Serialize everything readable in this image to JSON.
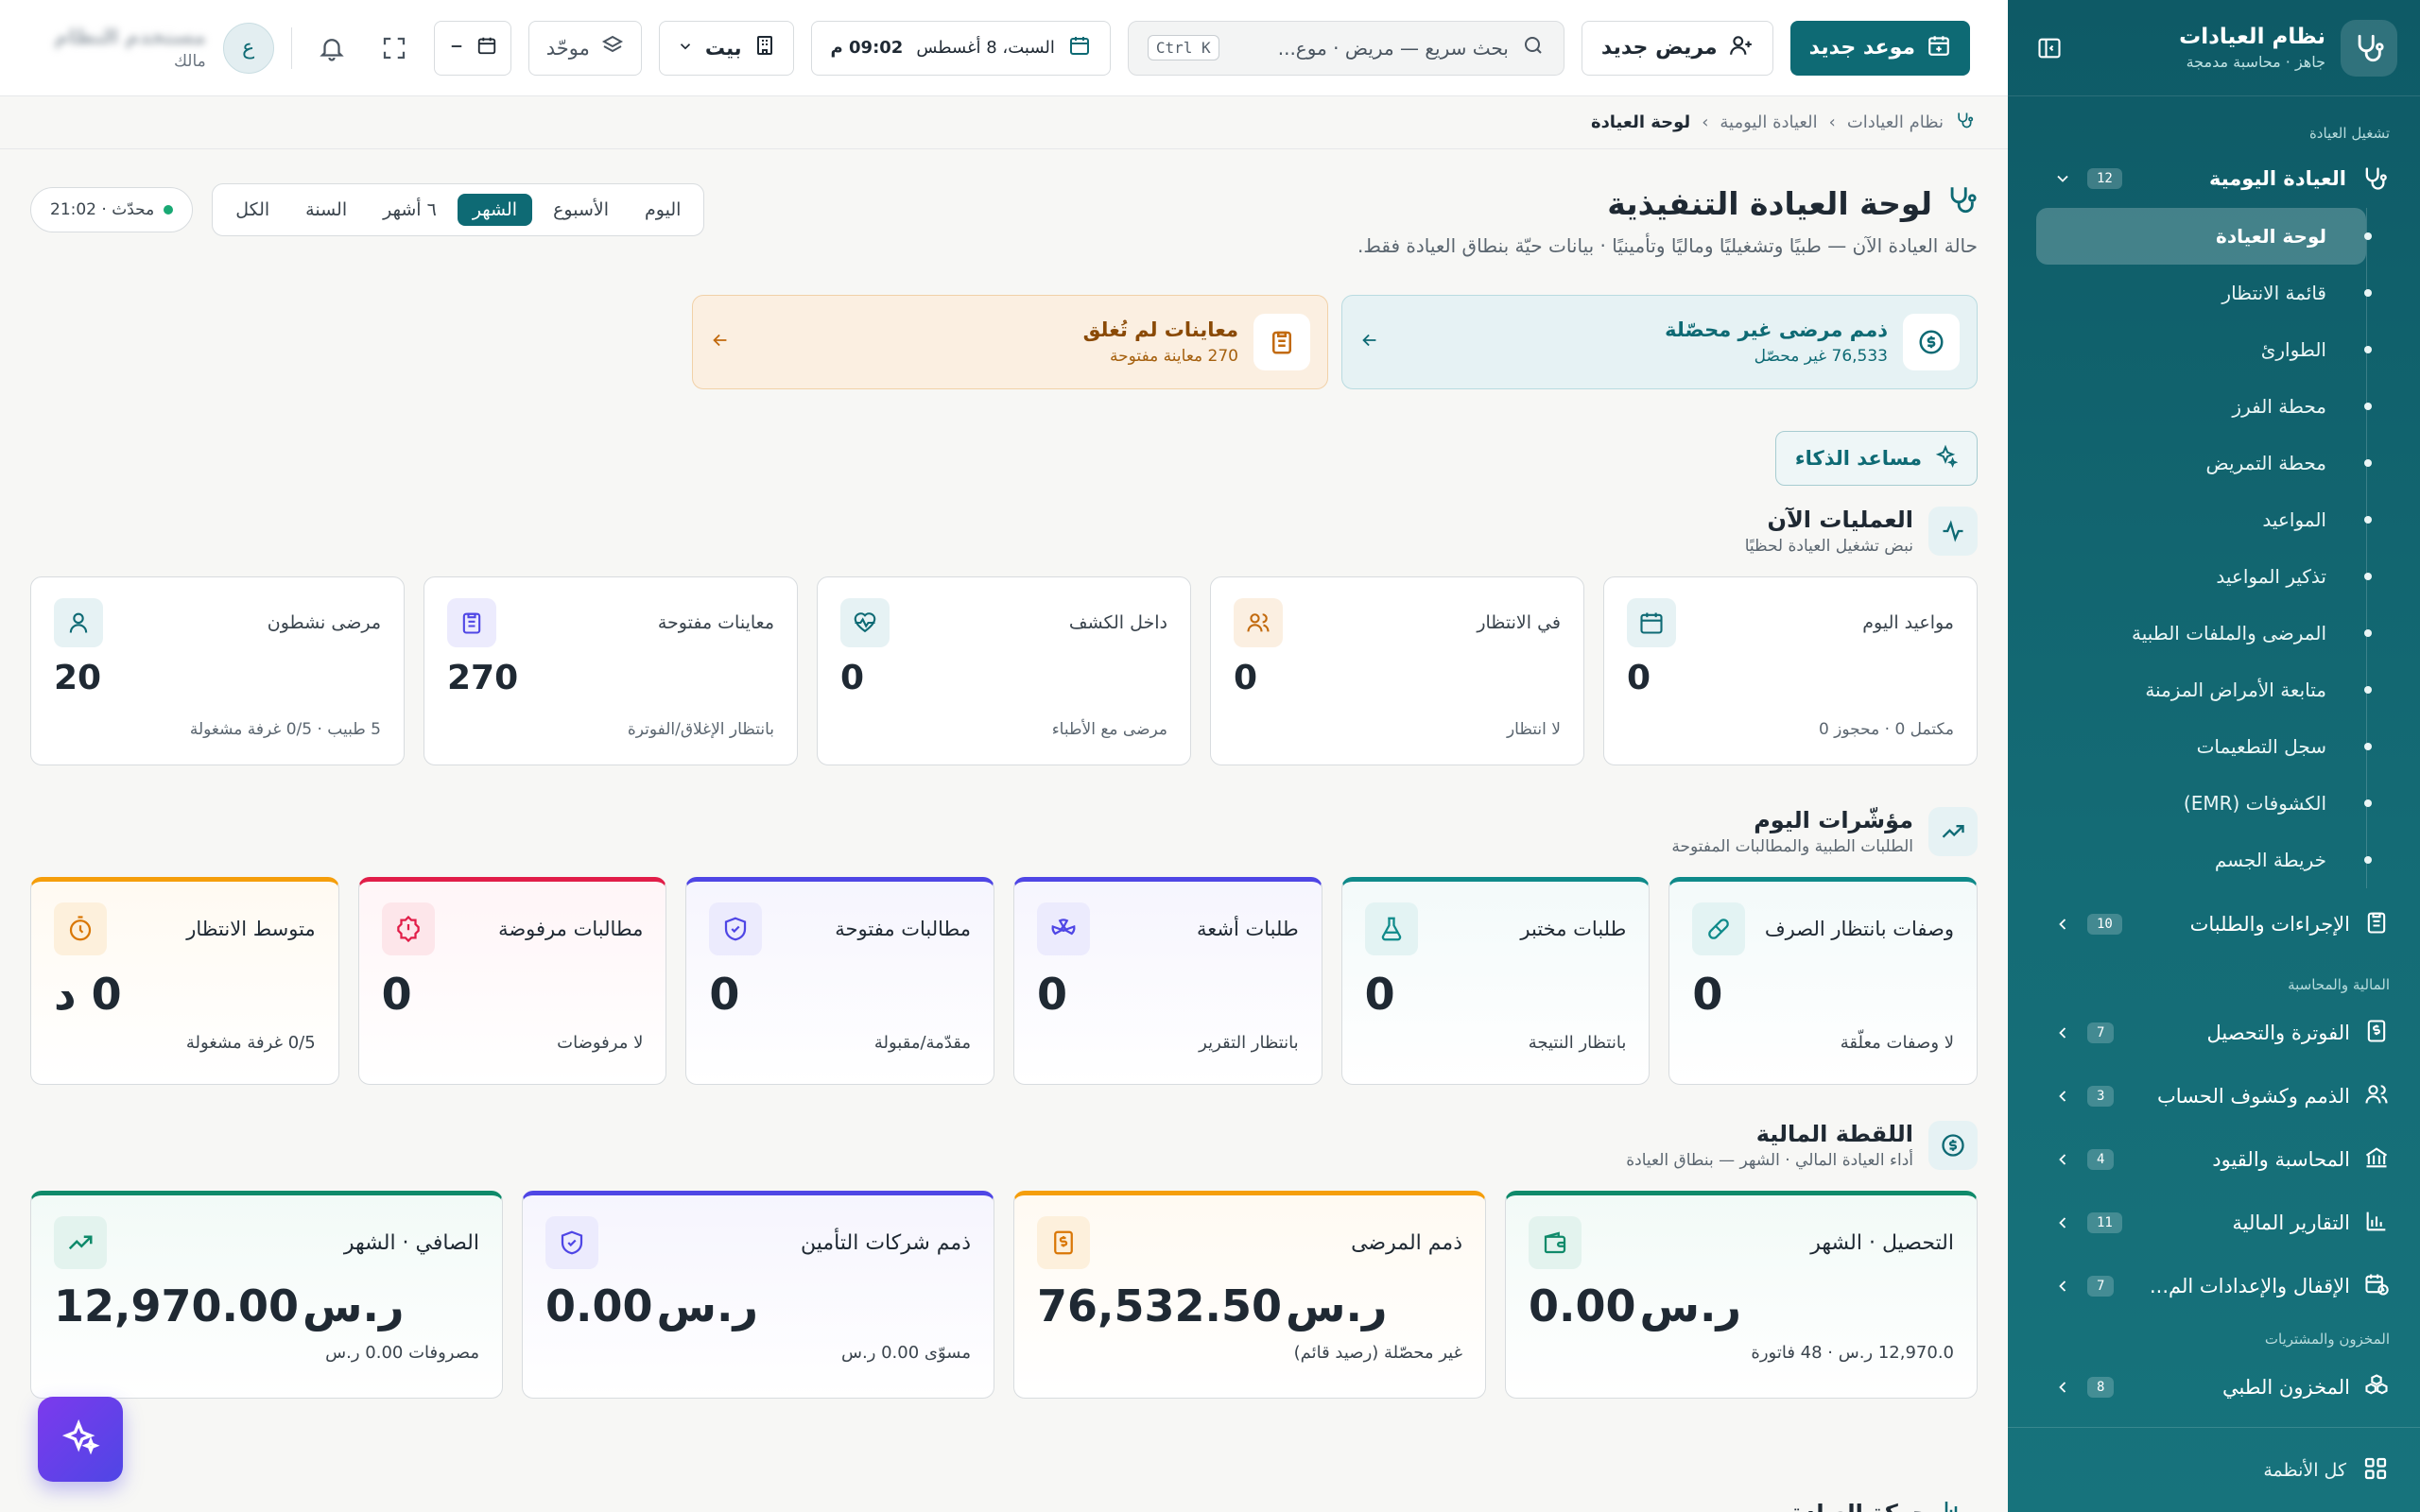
{
  "sidebar": {
    "app_title": "نظام العيادات",
    "app_subtitle": "جاهز · محاسبة مدمجة",
    "group_clinic": "تشغيل العيادة",
    "daily": {
      "label": "العيادة اليومية",
      "badge": "12"
    },
    "daily_children": [
      "لوحة العيادة",
      "قائمة الانتظار",
      "الطوارئ",
      "محطة الفرز",
      "محطة التمريض",
      "المواعيد",
      "تذكير المواعيد",
      "المرضى والملفات الطبية",
      "متابعة الأمراض المزمنة",
      "سجل التطعيمات",
      "الكشوفات (EMR)",
      "خريطة الجسم"
    ],
    "procedures": {
      "label": "الإجراءات والطلبات",
      "badge": "10"
    },
    "group_finance": "المالية والمحاسبة",
    "finance_items": [
      {
        "label": "الفوترة والتحصيل",
        "badge": "7"
      },
      {
        "label": "الذمم وكشوف الحساب",
        "badge": "3"
      },
      {
        "label": "المحاسبة والقيود",
        "badge": "4"
      },
      {
        "label": "التقارير المالية",
        "badge": "11"
      },
      {
        "label": "الإقفال والإعدادات الم...",
        "badge": "7"
      }
    ],
    "group_inventory": "المخزون والمشتريات",
    "inventory": {
      "label": "المخزون الطبي",
      "badge": "8"
    },
    "footer": "كل الأنظمة"
  },
  "topbar": {
    "new_appointment": "موعد جديد",
    "new_patient": "مريض جديد",
    "search_placeholder": "بحث سريع — مريض · موع...",
    "search_kbd": "Ctrl K",
    "date_text": "السبت، 8 أغسطس",
    "time_text": "09:02 م",
    "branch": "بيت",
    "unified": "موحّد",
    "user_name": "مستخدم النظام",
    "user_role": "مالك",
    "avatar_letter": "ع"
  },
  "breadcrumb": [
    "نظام العيادات",
    "العيادة اليومية",
    "لوحة العيادة"
  ],
  "page": {
    "title": "لوحة العيادة التنفيذية",
    "subtitle": "حالة العيادة الآن — طبيًا وتشغيليًا وماليًا وتأمينيًا · بيانات حيّة بنطاق العيادة فقط.",
    "periods": [
      "اليوم",
      "الأسبوع",
      "الشهر",
      "٦ أشهر",
      "السنة",
      "الكل"
    ],
    "active_period": "الشهر",
    "updated": "محدّث · 21:02"
  },
  "alerts": [
    {
      "title": "ذمم مرضى غير محصّلة",
      "sub": "76,533 غير محصّل",
      "tone": "teal"
    },
    {
      "title": "معاينات لم تُغلق",
      "sub": "270 معاينة مفتوحة",
      "tone": "orange"
    }
  ],
  "ai_button": "مساعد الذكاء",
  "operations": {
    "title": "العمليات الآن",
    "subtitle": "نبض تشغيل العيادة لحظيًا",
    "cards": [
      {
        "label": "مواعيد اليوم",
        "value": "0",
        "footer": "مكتمل 0 · محجوز 0",
        "icon": "calendar-icon",
        "color": "#0e6a74",
        "bg": "#e6f2f4"
      },
      {
        "label": "في الانتظار",
        "value": "0",
        "footer": "لا انتظار",
        "icon": "users-icon",
        "color": "#c26a0e",
        "bg": "#fbefe1"
      },
      {
        "label": "داخل الكشف",
        "value": "0",
        "footer": "مرضى مع الأطباء",
        "icon": "heart-pulse-icon",
        "color": "#0e6a74",
        "bg": "#e6f2f4"
      },
      {
        "label": "معاينات مفتوحة",
        "value": "270",
        "footer": "بانتظار الإغلاق/الفوترة",
        "icon": "clipboard-icon",
        "color": "#4f46e5",
        "bg": "#ecebfd"
      },
      {
        "label": "مرضى نشطون",
        "value": "20",
        "footer": "5 طبيب · 0/5 غرفة مشغولة",
        "icon": "user-icon",
        "color": "#0e6a74",
        "bg": "#e6f2f4"
      }
    ]
  },
  "indicators": {
    "title": "مؤشّرات اليوم",
    "subtitle": "الطلبات الطبية والمطالبات المفتوحة",
    "cards": [
      {
        "label": "وصفات بانتظار الصرف",
        "value": "0",
        "footer": "لا وصفات معلّقة",
        "icon": "pill-icon",
        "accent": "#0f8a8a",
        "bg": "#e3f3f3"
      },
      {
        "label": "طلبات مختبر",
        "value": "0",
        "footer": "بانتظار النتيجة",
        "icon": "flask-icon",
        "accent": "#0f8a8a",
        "bg": "#e3f3f3"
      },
      {
        "label": "طلبات أشعة",
        "value": "0",
        "footer": "بانتظار التقرير",
        "icon": "radiation-icon",
        "accent": "#4f46e5",
        "bg": "#ecebfd"
      },
      {
        "label": "مطالبات مفتوحة",
        "value": "0",
        "footer": "مقدّمة/مقبولة",
        "icon": "shield-check-icon",
        "accent": "#4f46e5",
        "bg": "#ecebfd"
      },
      {
        "label": "مطالبات مرفوضة",
        "value": "0",
        "footer": "لا مرفوضات",
        "icon": "alert-badge-icon",
        "accent": "#e11d48",
        "bg": "#fde6ea"
      },
      {
        "label": "متوسط الانتظار",
        "value": "0 د",
        "footer": "0/5 غرفة مشغولة",
        "icon": "timer-icon",
        "accent": "#f59e0b",
        "bg": "#fdf0dc"
      }
    ]
  },
  "finance": {
    "title": "اللقطة المالية",
    "subtitle": "أداء العيادة المالي · الشهر — بنطاق العيادة",
    "currency": "ر.س",
    "cards": [
      {
        "label": "التحصيل · الشهر",
        "value": "0.00",
        "footer": "12,970.0 ر.س · 48 فاتورة",
        "icon": "wallet-icon",
        "accent": "#0f8a6a",
        "bg": "#e3f3ee"
      },
      {
        "label": "ذمم المرضى",
        "value": "76,532.50",
        "footer": "غير محصّلة (رصيد قائم)",
        "icon": "receipt-icon",
        "accent": "#f59e0b",
        "bg": "#fdf0dc"
      },
      {
        "label": "ذمم شركات التأمين",
        "value": "0.00",
        "footer": "مسوّى 0.00 ر.س",
        "icon": "shield-icon",
        "accent": "#4f46e5",
        "bg": "#ecebfd"
      },
      {
        "label": "الصافي · الشهر",
        "value": "12,970.00",
        "footer": "مصروفات 0.00 ر.س",
        "icon": "trend-up-icon",
        "accent": "#0f8a6a",
        "bg": "#e3f3ee"
      }
    ]
  },
  "next_section_title": "حركة العيادة"
}
